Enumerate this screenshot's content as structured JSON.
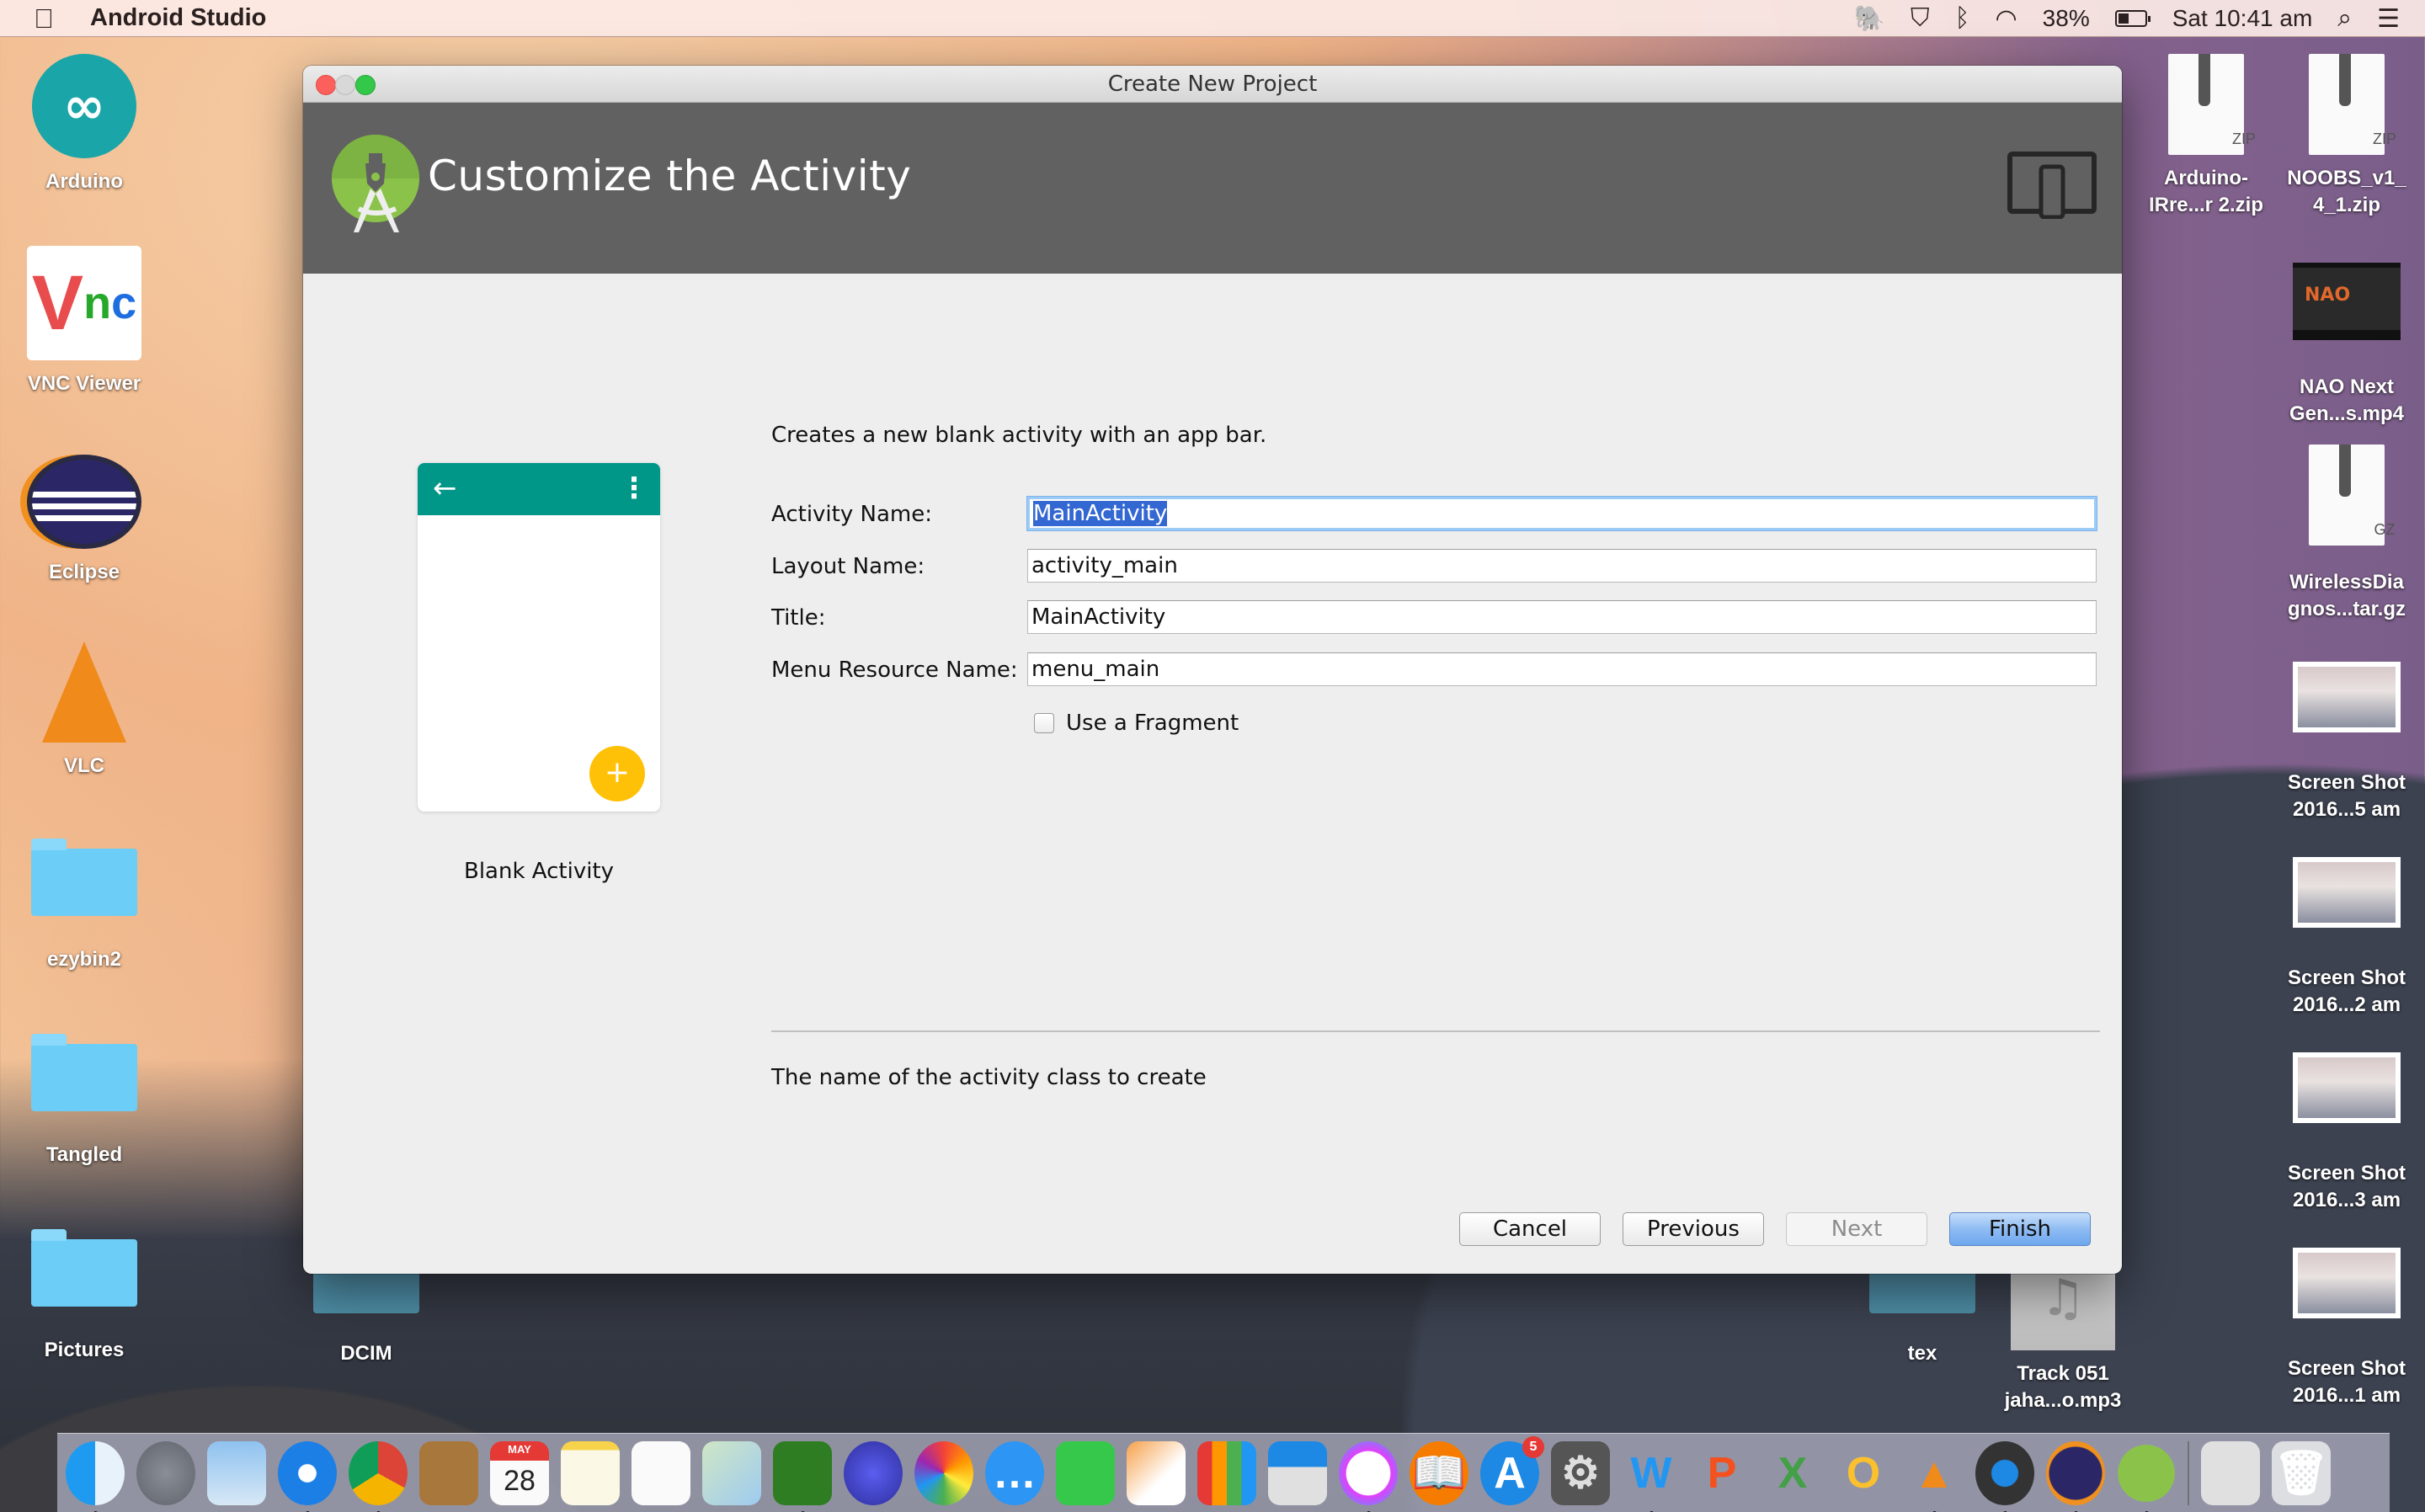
{
  "menubar": {
    "app_name": "Android Studio",
    "tray": {
      "battery_percent": "38%",
      "clock": "Sat 10:41 am",
      "icons": [
        "evernote-icon",
        "shield-icon",
        "bluetooth-icon",
        "wifi-icon",
        "battery-icon",
        "spotlight-search-icon",
        "notification-center-icon"
      ]
    }
  },
  "desktop": {
    "left_icons": [
      {
        "label": "Arduino",
        "icon": "arduino-icon"
      },
      {
        "label": "VNC Viewer",
        "icon": "vnc-icon"
      },
      {
        "label": "Eclipse",
        "icon": "eclipse-icon"
      },
      {
        "label": "VLC",
        "icon": "vlc-icon"
      },
      {
        "label": "ezybin2",
        "icon": "folder-icon"
      },
      {
        "label": "Tangled",
        "icon": "folder-icon"
      },
      {
        "label": "Pictures",
        "icon": "folder-icon"
      }
    ],
    "bottom_icons": [
      {
        "label": "DCIM",
        "icon": "folder-icon"
      },
      {
        "label": "tex",
        "icon": "folder-icon"
      },
      {
        "label": "Track 051\njaha...o.mp3",
        "line1": "Track 051",
        "line2": "jaha...o.mp3",
        "icon": "music-file-icon"
      }
    ],
    "right_icons": [
      {
        "line1": "Arduino-",
        "line2": "IRre...r 2.zip",
        "ext": "ZIP"
      },
      {
        "line1": "NOOBS_v1_",
        "line2": "4_1.zip",
        "ext": "ZIP"
      },
      {
        "line1": "NAO Next",
        "line2": "Gen...s.mp4",
        "thumb_text": "NAO"
      },
      {
        "line1": "WirelessDia",
        "line2": "gnos...tar.gz",
        "ext": "GZ"
      },
      {
        "line1": "Screen Shot",
        "line2": "2016...5 am"
      },
      {
        "line1": "Screen Shot",
        "line2": "2016...2 am"
      },
      {
        "line1": "Screen Shot",
        "line2": "2016...3 am"
      },
      {
        "line1": "Screen Shot",
        "line2": "2016...1 am"
      }
    ]
  },
  "dialog": {
    "window_title": "Create New Project",
    "header_title": "Customize the Activity",
    "preview": {
      "template_name": "Blank Activity",
      "toolbar_color": "#009688",
      "fab_color": "#FFC107",
      "back_glyph": "←",
      "more_glyph": "⋮",
      "fab_glyph": "+"
    },
    "description": "Creates a new blank activity with an app bar.",
    "fields": [
      {
        "label": "Activity Name:",
        "value": "MainActivity",
        "focused": true
      },
      {
        "label": "Layout Name:",
        "value": "activity_main"
      },
      {
        "label": "Title:",
        "value": "MainActivity"
      },
      {
        "label": "Menu Resource Name:",
        "value": "menu_main"
      }
    ],
    "use_fragment": {
      "label": "Use a Fragment",
      "checked": false
    },
    "help_text": "The name of the activity class to create",
    "buttons": {
      "cancel": "Cancel",
      "previous": "Previous",
      "next": "Next",
      "finish": "Finish"
    }
  },
  "dock": {
    "items": [
      {
        "name": "Finder",
        "running": true
      },
      {
        "name": "Launchpad"
      },
      {
        "name": "Mail"
      },
      {
        "name": "Safari",
        "running": true
      },
      {
        "name": "Chrome",
        "running": true
      },
      {
        "name": "Contacts"
      },
      {
        "name": "Calendar",
        "month": "MAY",
        "day": "28"
      },
      {
        "name": "Notes"
      },
      {
        "name": "Reminders"
      },
      {
        "name": "Maps"
      },
      {
        "name": "Shield App",
        "running": true
      },
      {
        "name": "Network Utility"
      },
      {
        "name": "Photos"
      },
      {
        "name": "Messages"
      },
      {
        "name": "FaceTime"
      },
      {
        "name": "Pages"
      },
      {
        "name": "Numbers"
      },
      {
        "name": "Keynote"
      },
      {
        "name": "iTunes",
        "running": true
      },
      {
        "name": "iBooks"
      },
      {
        "name": "App Store",
        "badge": "5"
      },
      {
        "name": "System Preferences"
      },
      {
        "name": "Word",
        "running": true
      },
      {
        "name": "PowerPoint"
      },
      {
        "name": "Excel"
      },
      {
        "name": "Outlook"
      },
      {
        "name": "VLC",
        "running": true
      },
      {
        "name": "QuickTime Player",
        "running": true
      },
      {
        "name": "Eclipse",
        "running": true
      },
      {
        "name": "Android Studio",
        "running": true
      },
      {
        "name": "Downloads Stack"
      },
      {
        "name": "Trash"
      }
    ]
  }
}
